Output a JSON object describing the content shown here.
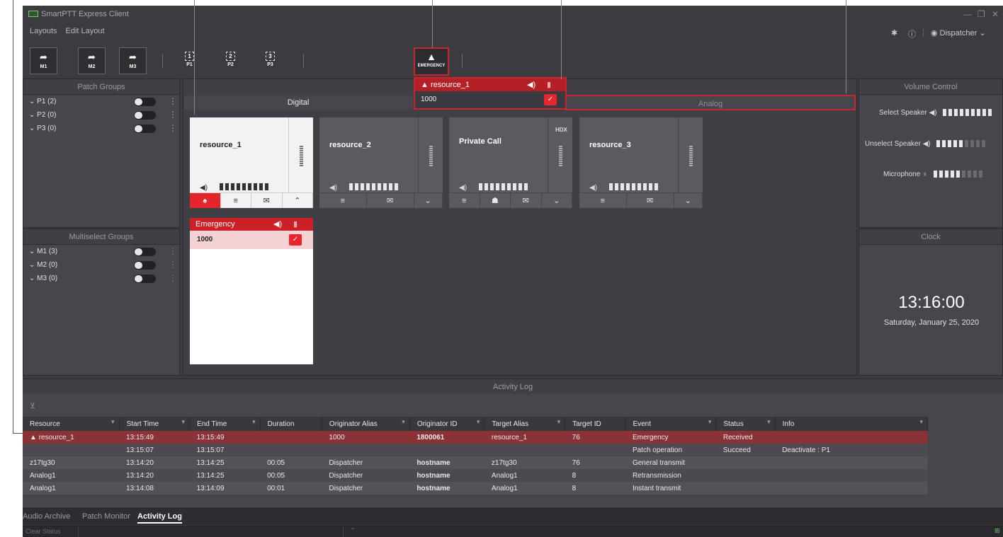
{
  "app": {
    "title": "SmartPTT Express Client",
    "menu": [
      "Layouts",
      "Edit Layout"
    ],
    "user": "Dispatcher"
  },
  "toolbar": {
    "multiselect": [
      "M1",
      "M2",
      "M3"
    ],
    "patches": [
      {
        "num": "1",
        "label": "P1"
      },
      {
        "num": "2",
        "label": "P2"
      },
      {
        "num": "3",
        "label": "P3"
      }
    ],
    "emergency_label": "EMERGENCY"
  },
  "patch_groups": {
    "title": "Patch Groups",
    "items": [
      "P1 (2)",
      "P2 (0)",
      "P3 (0)"
    ]
  },
  "multiselect_groups": {
    "title": "Multiselect Groups",
    "items": [
      "M1 (3)",
      "M2 (0)",
      "M3 (0)"
    ]
  },
  "tabs": {
    "digital": "Digital",
    "analog": "Analog"
  },
  "emergency_popup": {
    "title": "resource_1",
    "value": "1000"
  },
  "tiles": [
    {
      "name": "resource_1"
    },
    {
      "name": "resource_2"
    },
    {
      "name": "Private Call",
      "badge": "HDX"
    },
    {
      "name": "resource_3"
    }
  ],
  "tile_dropdown": {
    "title": "Emergency",
    "value": "1000"
  },
  "volume": {
    "title": "Volume Control",
    "select": "Select Speaker",
    "unselect": "Unselect Speaker",
    "mic": "Microphone",
    "levels": {
      "select": 1.0,
      "unselect": 0.6,
      "mic": 0.5
    }
  },
  "clock": {
    "title": "Clock",
    "time": "13:16:00",
    "date": "Saturday, January 25, 2020"
  },
  "activity_log": {
    "title": "Activity Log",
    "columns": [
      "Resource",
      "Start Time",
      "End Time",
      "Duration",
      "Originator Alias",
      "Originator ID",
      "Target Alias",
      "Target ID",
      "Event",
      "Status",
      "Info"
    ],
    "rows": [
      [
        "resource_1",
        "13:15:49",
        "13:15:49",
        "",
        "1000",
        "1800061",
        "resource_1",
        "76",
        "Emergency",
        "Received",
        ""
      ],
      [
        "",
        "13:15:07",
        "13:15:07",
        "",
        "",
        "",
        "",
        "",
        "Patch operation",
        "Succeed",
        "Deactivate : P1"
      ],
      [
        "z17tg30",
        "13:14:20",
        "13:14:25",
        "00:05",
        "Dispatcher",
        "hostname",
        "z17tg30",
        "76",
        "General transmit",
        "",
        ""
      ],
      [
        "Analog1",
        "13:14:20",
        "13:14:25",
        "00:05",
        "Dispatcher",
        "hostname",
        "Analog1",
        "8",
        "Retransmission",
        "",
        ""
      ],
      [
        "Analog1",
        "13:14:08",
        "13:14:09",
        "00:01",
        "Dispatcher",
        "hostname",
        "Analog1",
        "8",
        "Instant transmit",
        "",
        ""
      ]
    ]
  },
  "bottom_tabs": [
    "Audio Archive",
    "Patch Monitor",
    "Activity Log"
  ],
  "status": {
    "clear": "Clear Status"
  },
  "colors": {
    "bg": "#3b3b40",
    "panel": "#46464c",
    "emergency": "#c8262c",
    "selected_row": "#8b3236"
  }
}
